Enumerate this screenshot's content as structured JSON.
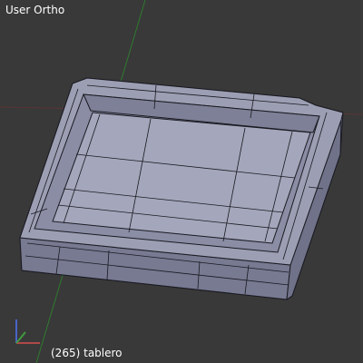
{
  "viewport": {
    "view_name": "User Ortho",
    "frame_number": "(265)",
    "object_name": "tablero"
  },
  "colors": {
    "background": "#393939",
    "mesh_face": "#9c9fb3",
    "mesh_side": "#8c8fa6",
    "mesh_dark": "#6f7288",
    "wire": "#1a1a22",
    "axis_x": "#b04848",
    "axis_y": "#3f9a3f",
    "axis_z": "#4a64c8"
  },
  "icons": {
    "axes_gizmo": "xyz-axes-icon"
  }
}
